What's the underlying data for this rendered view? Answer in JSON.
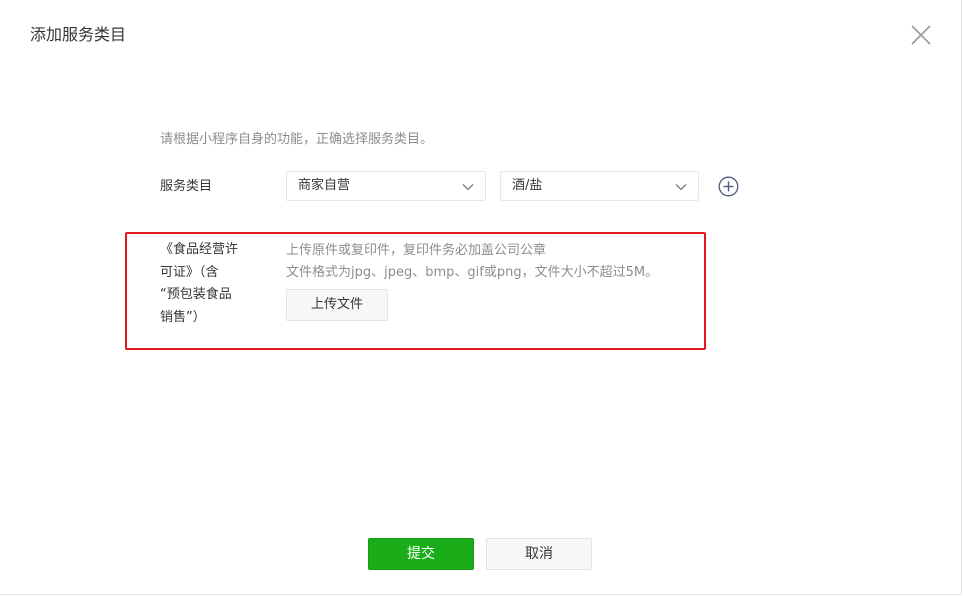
{
  "dialog": {
    "title": "添加服务类目",
    "close_icon": "close-icon"
  },
  "form": {
    "hint": "请根据小程序自身的功能，正确选择服务类目。",
    "category_label": "服务类目",
    "category_primary": "商家自营",
    "category_secondary": "酒/盐",
    "add_icon": "plus-circle-icon"
  },
  "qualification": {
    "highlight_color": "#e1191e",
    "label_lines": [
      "《食品经营许",
      "可证》（含",
      "“预包装食品",
      "销售”）"
    ],
    "desc_line1": "上传原件或复印件，复印件务必加盖公司公章",
    "desc_line2": "文件格式为jpg、jpeg、bmp、gif或png，文件大小不超过5M。",
    "upload_label": "上传文件"
  },
  "footer": {
    "submit_label": "提交",
    "cancel_label": "取消",
    "submit_color": "#1aad19"
  }
}
